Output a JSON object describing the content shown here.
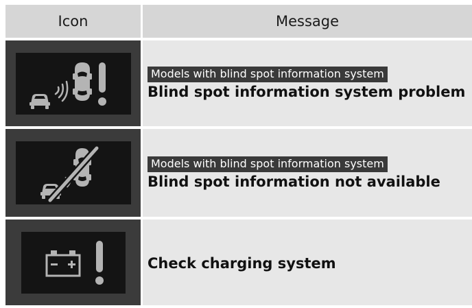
{
  "header": {
    "icon": "Icon",
    "message": "Message"
  },
  "rows": [
    {
      "icon": "blind-spot-problem-icon",
      "tag": "Models with blind spot information system",
      "message": "Blind spot information system problem"
    },
    {
      "icon": "blind-spot-unavailable-icon",
      "tag": "Models with blind spot information system",
      "message": "Blind spot information not available"
    },
    {
      "icon": "charging-system-icon",
      "tag": "",
      "message": "Check charging system"
    }
  ],
  "colors": {
    "header_bg": "#d6d6d6",
    "row_bg": "#e7e7e7",
    "icon_cell_bg": "#3b3b3b",
    "panel_bg": "#141414",
    "symbol": "#b4b4b4",
    "tag_bg": "#3a3a3a"
  }
}
